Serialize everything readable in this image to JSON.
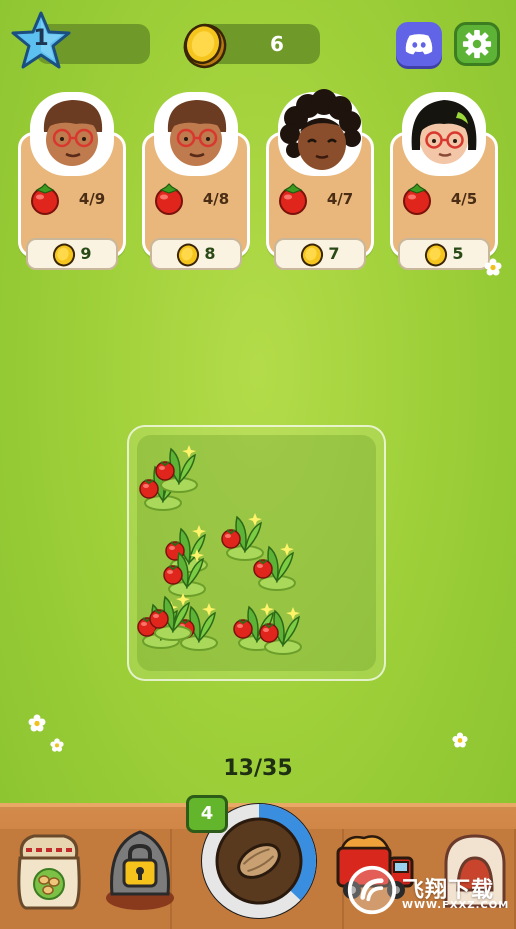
{
  "hud": {
    "level": "1",
    "coins": "6",
    "discord_icon": "discord-icon",
    "settings_icon": "gear-icon"
  },
  "customers": [
    {
      "avatar": "curly-hair-glasses-man",
      "item": "tomato",
      "order": "4/9",
      "price": "9"
    },
    {
      "avatar": "curly-hair-glasses-man",
      "item": "tomato",
      "order": "4/8",
      "price": "8"
    },
    {
      "avatar": "afro-hair-woman",
      "item": "tomato",
      "order": "4/7",
      "price": "7"
    },
    {
      "avatar": "bob-hair-glasses-woman",
      "item": "tomato",
      "order": "4/5",
      "price": "5"
    }
  ],
  "field": {
    "crop": "tomato",
    "plant_count": 11
  },
  "storage": {
    "capacity": "13/35",
    "level": "4",
    "fill_fraction": 0.37
  },
  "watermark": {
    "title": "飞翔下载",
    "url": "WWW.FXXZ.COM"
  },
  "colors": {
    "grass": "#9fd03a",
    "card": "#e9b77c",
    "tray": "#c27a3d",
    "ring_fill": "#3a8ee0"
  }
}
